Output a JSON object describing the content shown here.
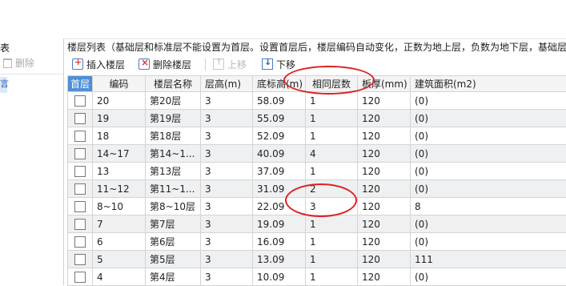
{
  "left_panel": {
    "title": "表",
    "delete_label": "删除",
    "selected_glyph": "言"
  },
  "floor_list_title": "楼层列表（基础层和标准层不能设置为首层。设置首层后，楼层编码自动变化，正数为地上层，负数为地下层，基础层",
  "toolbar": {
    "insert_label": "插入楼层",
    "delete_label": "删除楼层",
    "up_label": "上移",
    "down_label": "下移"
  },
  "columns": [
    "首层",
    "编码",
    "楼层名称",
    "层高(m)",
    "底标高(m)",
    "相同层数",
    "板厚(mm)",
    "建筑面积(m2)"
  ],
  "rows": [
    {
      "code": "20",
      "name": "第20层",
      "height": "3",
      "elev": "58.09",
      "same": "1",
      "slab": "120",
      "area": "(0)"
    },
    {
      "code": "19",
      "name": "第19层",
      "height": "3",
      "elev": "55.09",
      "same": "1",
      "slab": "120",
      "area": "(0)"
    },
    {
      "code": "18",
      "name": "第18层",
      "height": "3",
      "elev": "52.09",
      "same": "1",
      "slab": "120",
      "area": "(0)"
    },
    {
      "code": "14~17",
      "name": "第14~1...",
      "height": "3",
      "elev": "40.09",
      "same": "4",
      "slab": "120",
      "area": "(0)"
    },
    {
      "code": "13",
      "name": "第13层",
      "height": "3",
      "elev": "37.09",
      "same": "1",
      "slab": "120",
      "area": "(0)"
    },
    {
      "code": "11~12",
      "name": "第11~1...",
      "height": "3",
      "elev": "31.09",
      "same": "2",
      "slab": "120",
      "area": "(0)"
    },
    {
      "code": "8~10",
      "name": "第8~10层",
      "height": "3",
      "elev": "22.09",
      "same": "3",
      "slab": "120",
      "area": "8"
    },
    {
      "code": "7",
      "name": "第7层",
      "height": "3",
      "elev": "19.09",
      "same": "1",
      "slab": "120",
      "area": "(0)"
    },
    {
      "code": "6",
      "name": "第6层",
      "height": "3",
      "elev": "16.09",
      "same": "1",
      "slab": "120",
      "area": "(0)"
    },
    {
      "code": "5",
      "name": "第5层",
      "height": "3",
      "elev": "13.09",
      "same": "1",
      "slab": "120",
      "area": "111"
    },
    {
      "code": "4",
      "name": "第4层",
      "height": "3",
      "elev": "10.09",
      "same": "1",
      "slab": "120",
      "area": "(0)"
    }
  ],
  "colors": {
    "header_accent": "#4f8fd6",
    "annotation": "#e02020",
    "alt_row": "#eef0f2"
  }
}
